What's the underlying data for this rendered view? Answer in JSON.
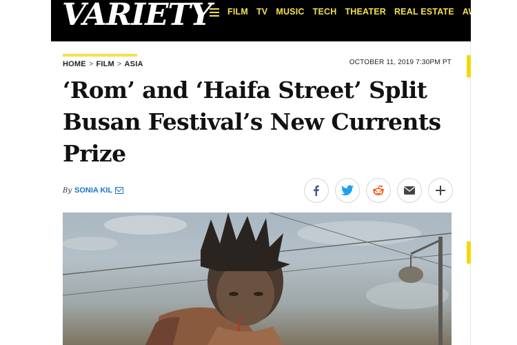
{
  "header": {
    "logo": "VARIETY",
    "nav": [
      "FILM",
      "TV",
      "MUSIC",
      "TECH",
      "THEATER",
      "REAL ESTATE",
      "AWARDS"
    ]
  },
  "article": {
    "breadcrumb": [
      "HOME",
      "FILM",
      "ASIA"
    ],
    "timestamp": "OCTOBER 11, 2019 7:30PM PT",
    "headline": "‘Rom’ and ‘Haifa Street’ Split Busan Festival’s New Currents Prize",
    "byline_prefix": "By",
    "author": "SONIA KIL"
  },
  "share": [
    "facebook-icon",
    "twitter-icon",
    "reddit-icon",
    "email-icon",
    "plus-icon"
  ],
  "colors": {
    "header_bg": "#000000",
    "nav_accent": "#f5e14b",
    "author_link": "#1a73c8"
  }
}
